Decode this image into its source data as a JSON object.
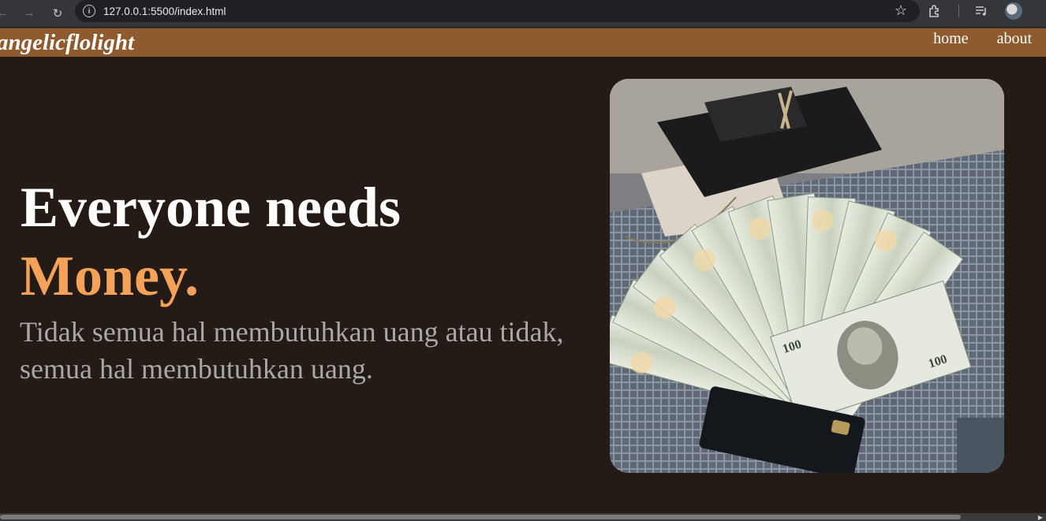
{
  "browser": {
    "url": "127.0.0.1:5500/index.html",
    "icons": [
      "back-arrow-icon",
      "forward-arrow-icon",
      "reload-icon",
      "site-info-icon",
      "bookmark-star-icon",
      "extensions-icon",
      "media-controls-icon",
      "profile-avatar-icon"
    ]
  },
  "site": {
    "logo": "angelicflolight",
    "nav": {
      "home": "home",
      "about": "about"
    }
  },
  "hero": {
    "title": "Everyone needs",
    "accent": "Money.",
    "subtitle": "Tidak semua hal membutuhkan uang atau tidak, semua hal membutuhkan uang.",
    "image_subject": "fanned 100 dollar bills with black quilted wallet and credit card on a woven placemat"
  },
  "colors": {
    "background": "#241b17",
    "header": "#8f5a2e",
    "accent": "#f4a259",
    "subtitle": "#a8a8a8"
  }
}
